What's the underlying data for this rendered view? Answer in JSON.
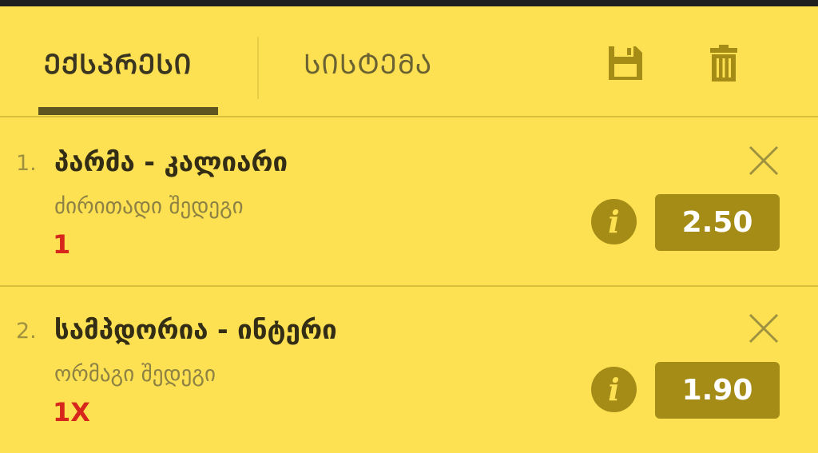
{
  "tabs": [
    {
      "label": "ᲔᲥᲡᲞᲠᲔᲡᲘ",
      "active": true
    },
    {
      "label": "ᲡᲘᲡᲢᲔᲛᲐ",
      "active": false
    }
  ],
  "toolbar": {
    "save_icon": "save-icon",
    "trash_icon": "trash-icon"
  },
  "bets": [
    {
      "number": "1.",
      "match": "პარმა - კალიარი",
      "market": "ძირითადი შედეგი",
      "pick": "1",
      "odds": "2.50"
    },
    {
      "number": "2.",
      "match": "სამპდორია - ინტერი",
      "market": "ორმაგი შედეგი",
      "pick": "1X",
      "odds": "1.90"
    }
  ],
  "info_glyph": "i",
  "colors": {
    "background": "#fde152",
    "accent": "#a58c17",
    "pick": "#d7261c",
    "title": "#332d16"
  }
}
